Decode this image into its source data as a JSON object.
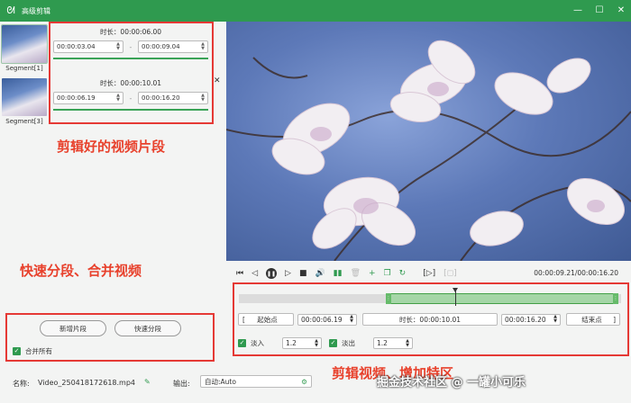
{
  "window": {
    "title": "高级剪辑",
    "logo": "rabbit-icon",
    "controls": {
      "minimize": "—",
      "maximize": "☐",
      "close": "✕"
    }
  },
  "segments": [
    {
      "label": "Segment[1]"
    },
    {
      "label": "Segment[3]"
    }
  ],
  "clips": [
    {
      "duration": "时长：00:00:06.00",
      "start": "00:00:03.04",
      "end": "00:00:09.04"
    },
    {
      "duration": "时长：00:00:10.01",
      "start": "00:00:06.19",
      "end": "00:00:16.20"
    }
  ],
  "annotations": {
    "clips_note": "剪辑好的视频片段",
    "split_note": "快速分段、合并视频",
    "bottom_note": "剪辑视频、增加特区",
    "watermark": "掘金技术社区 @ 一罐小可乐"
  },
  "left_actions": {
    "add_segment": "新增片段",
    "quick_split": "快速分段",
    "merge_all": "合并所有",
    "merge_checked": true
  },
  "player": {
    "timecode": "00:00:09.21/00:00:16.20"
  },
  "trim": {
    "start_label": "起始点",
    "start_value": "00:00:06.19",
    "duration": "时长：00:00:10.01",
    "end_value": "00:00:16.20",
    "end_label": "结束点",
    "fade_in_label": "淡入",
    "fade_in_value": "1.2",
    "fade_out_label": "淡出",
    "fade_out_value": "1.2"
  },
  "footer": {
    "name_label": "名称:",
    "name_value": "Video_250418172618.mp4",
    "output_label": "输出:",
    "output_value": "自动:Auto"
  },
  "colors": {
    "accent": "#2f9a4f",
    "annotation": "#e8412c"
  }
}
